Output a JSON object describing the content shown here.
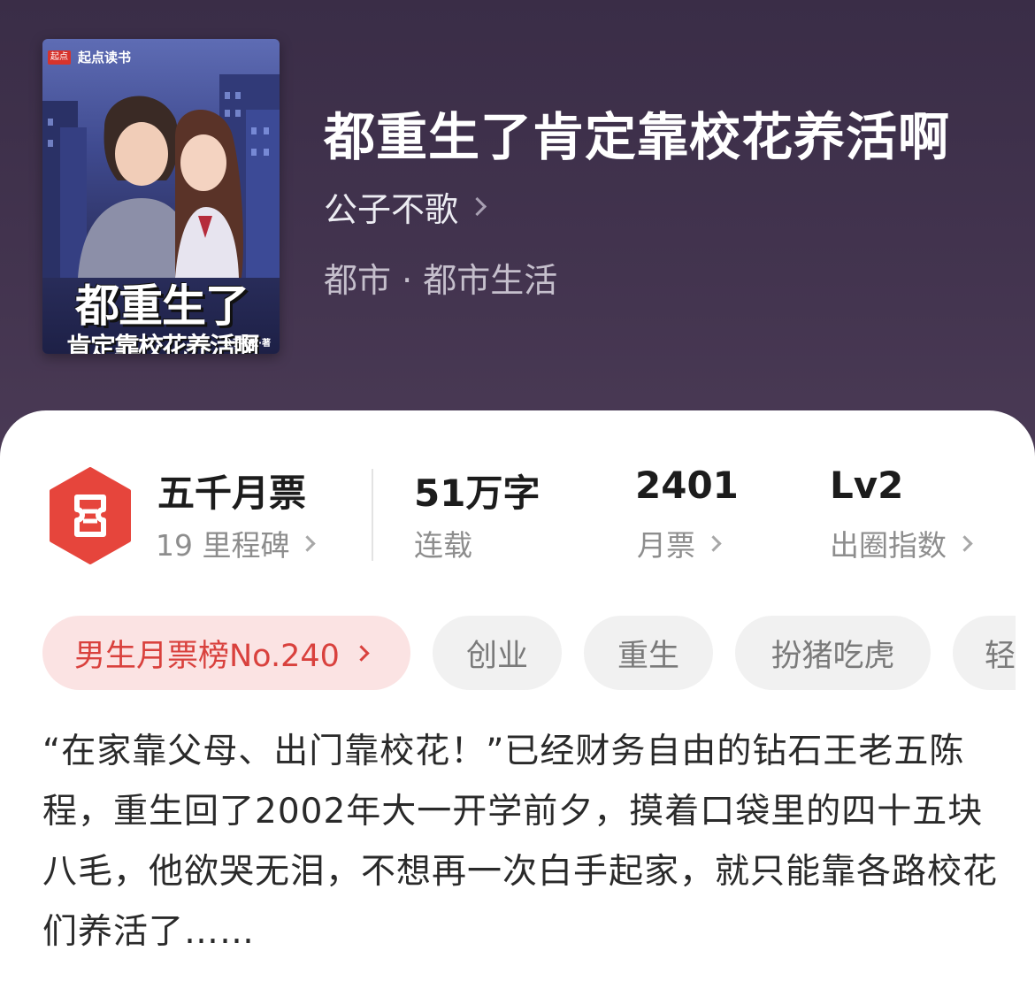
{
  "book": {
    "title": "都重生了肯定靠校花养活啊",
    "author": "公子不歌",
    "genre": "都市 · 都市生活"
  },
  "cover": {
    "logo_mark": "起点",
    "logo_text": "起点读书",
    "title_line1": "都重生了",
    "title_line2": "肯定靠校花养活啊",
    "author_credit": "公子不歌·著"
  },
  "stats": {
    "milestone": {
      "value": "五千月票",
      "label": "19 里程碑"
    },
    "words": {
      "value": "51万字",
      "label": "连载"
    },
    "monthly_tickets": {
      "value": "2401",
      "label": "月票"
    },
    "influence": {
      "value": "Lv2",
      "label": "出圈指数"
    }
  },
  "tags": {
    "rank": "男生月票榜No.240",
    "items": [
      "创业",
      "重生",
      "扮猪吃虎",
      "轻"
    ]
  },
  "description": "“在家靠父母、出门靠校花！”已经财务自由的钻石王老五陈程，重生回了2002年大一开学前夕，摸着口袋里的四十五块八毛，他欲哭无泪，不想再一次白手起家，就只能靠各路校花们养活了……",
  "colors": {
    "hero_bg": "#3d3049",
    "accent_red": "#e6453c",
    "rank_chip_bg": "#fbe3e3",
    "chip_bg": "#f1f1f1"
  },
  "icons": {
    "milestone": "ticket-icon",
    "chevron": "chevron-right-icon"
  }
}
